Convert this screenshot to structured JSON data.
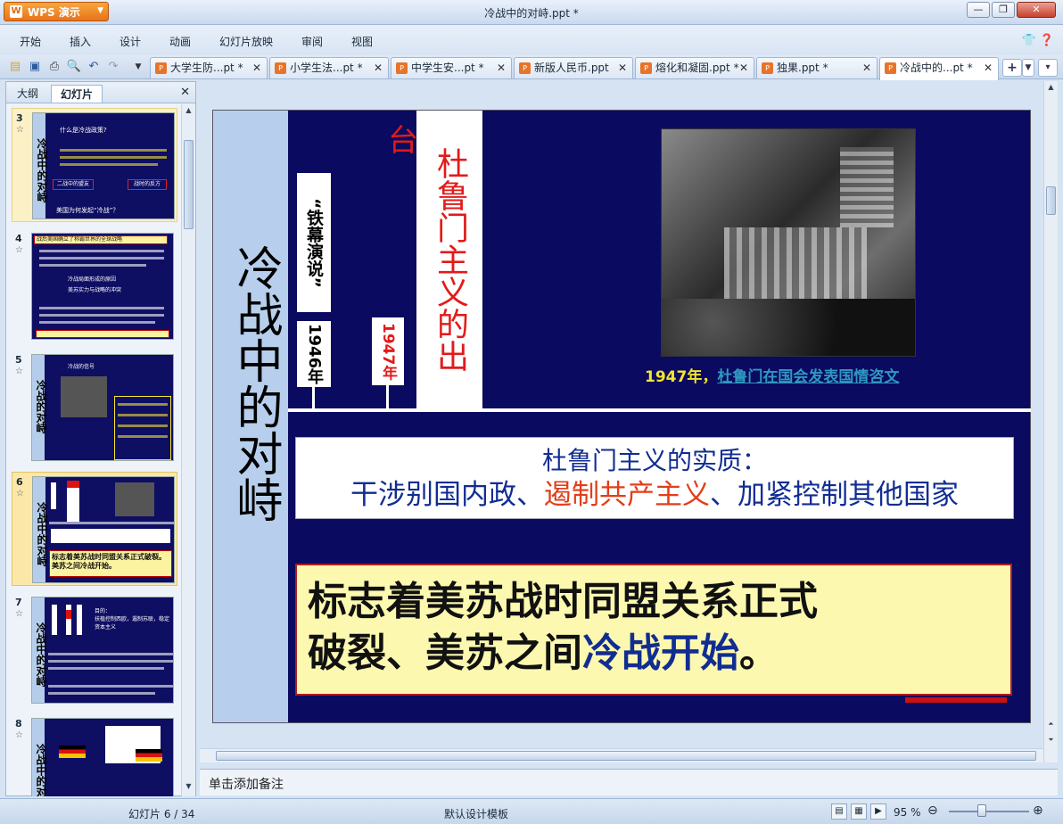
{
  "window": {
    "app_name": "WPS 演示",
    "title": "冷战中的对峙.ppt *",
    "controls": [
      "—",
      "❐",
      "✕"
    ]
  },
  "menu": [
    "开始",
    "插入",
    "设计",
    "动画",
    "幻灯片放映",
    "审阅",
    "视图"
  ],
  "tabs": [
    {
      "label": "大学生防...pt *"
    },
    {
      "label": "小学生法...pt *"
    },
    {
      "label": "中学生安...pt *"
    },
    {
      "label": "新版人民币.ppt"
    },
    {
      "label": "熔化和凝固.ppt *"
    },
    {
      "label": "独果.ppt *"
    },
    {
      "label": "冷战中的...pt *",
      "active": true
    }
  ],
  "left_panel": {
    "tabs": [
      "大纲",
      "幻灯片"
    ],
    "active_tab": "幻灯片",
    "slides": [
      {
        "num": "3",
        "title": "冷战中的对峙",
        "texts": [
          "什么是冷战政策?",
          "二战中的盟友",
          "战时的反方",
          "美国为何发起“冷战”？"
        ]
      },
      {
        "num": "4",
        "title": "",
        "texts": [
          "战后美国确立了称霸世界的全球战略",
          "冷战局面形成的原因",
          "美苏实力与战略的冲突"
        ]
      },
      {
        "num": "5",
        "title": "冷战的对峙",
        "texts": [
          "冷战的信号"
        ]
      },
      {
        "num": "6",
        "title": "冷战中的对峙",
        "selected": true,
        "texts": [
          "标志着美苏战时同盟关系正式破裂。美苏之间冷战开始。"
        ]
      },
      {
        "num": "7",
        "title": "冷战中的对峙",
        "texts": [
          "目的：",
          "扶植控制西欧，遏制苏联，稳定资本主义"
        ]
      },
      {
        "num": "8",
        "title": "冷战中的对峙",
        "texts": []
      }
    ]
  },
  "slide": {
    "side_title": "冷战中的对峙",
    "tag_1946_year": "1946年",
    "tag_iron_curtain": "“铁幕演说”",
    "tag_1947_year": "1947年",
    "tag_truman": "杜鲁门主义的出",
    "tag_truman_end": "台",
    "caption_year": "1947年，",
    "caption_link": "杜鲁门在国会发表国情咨文",
    "essence_title": "杜鲁门主义的实质：",
    "essence_part1": "干涉别国内政、",
    "essence_highlight": "遏制共产主义",
    "essence_part2": "、加紧控制其他国家",
    "conclusion_line1": "标志着美苏战时同盟关系正式",
    "conclusion_line2_a": "破裂、美苏之间",
    "conclusion_line2_b": "冷战开始",
    "conclusion_line2_c": "。"
  },
  "notes_placeholder": "单击添加备注",
  "status": {
    "slide_position": "幻灯片 6 / 34",
    "template": "默认设计模板",
    "zoom": "95 %"
  },
  "colors": {
    "slide_bg": "#0a0a60",
    "accent_blue": "#112d92",
    "accent_red": "#e33d19",
    "caption_yellow": "#f4e531"
  }
}
